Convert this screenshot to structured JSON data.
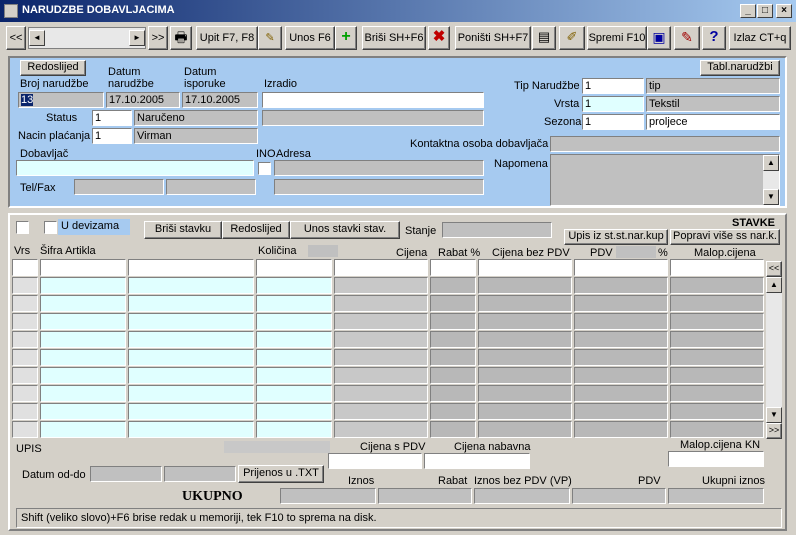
{
  "window": {
    "title": "NARUDZBE DOBAVLJACIMA"
  },
  "toolbar": {
    "upit": "Upit F7, F8",
    "unos": "Unos F6",
    "brisi": "Briši  SH+F6",
    "ponisti": "Poništi SH+F7",
    "spremi": "Spremi F10",
    "izlaz": "Izlaz CT+q",
    "nav_first": "<<",
    "nav_last": ">>"
  },
  "header": {
    "redoslijed": "Redoslijed",
    "tabl": "Tabl.narudžbi",
    "broj_label": "Broj narudžbe",
    "broj_value": "13",
    "datum_nar_label1": "Datum",
    "datum_nar_label2": "narudžbe",
    "datum_nar_value": "17.10.2005",
    "datum_isp_label1": "Datum",
    "datum_isp_label2": "isporuke",
    "datum_isp_value": "17.10.2005",
    "izradio_label": "Izradio",
    "status_label": "Status",
    "status_code": "1",
    "status_value": "Naručeno",
    "placanje_label": "Nacin plaćanja",
    "placanje_code": "1",
    "placanje_value": "Virman",
    "tip_label": "Tip Narudžbe",
    "tip_code": "1",
    "tip_value": "tip",
    "vrsta_label": "Vrsta",
    "vrsta_code": "1",
    "vrsta_value": "Tekstil",
    "sezona_label": "Sezona",
    "sezona_code": "1",
    "sezona_value": "proljece",
    "kontakt_label": "Kontaktna osoba dobavljača",
    "napomena_label": "Napomena",
    "dobavljac_label": "Dobavljač",
    "ino_label": "INO",
    "adresa_label": "Adresa",
    "telfax_label": "Tel/Fax"
  },
  "items": {
    "u_devizama": "U devizama",
    "brisi_stavku": "Briši stavku",
    "redoslijed": "Redoslijed",
    "unos_stavki": "Unos stavki stav.",
    "stanje_label": "Stanje",
    "stavke_title": "STAVKE",
    "upis_st": "Upis iz st.st.nar.kup",
    "popravi": "Popravi više ss nar.k.",
    "col_vrs": "Vrs",
    "col_sifra": "Šifra Artikla",
    "col_kolicina": "Količina",
    "col_cijena": "Cijena",
    "col_rabat": "Rabat %",
    "col_bez_pdv": "Cijena bez PDV",
    "col_pdv": "PDV",
    "col_pct": "%",
    "col_malop": "Malop.cijena",
    "nav_top": "<<",
    "nav_bottom": ">>"
  },
  "footer": {
    "upis": "UPIS",
    "cijena_s_pdv": "Cijena s PDV",
    "cijena_nabavna": "Cijena nabavna",
    "malop_kn": "Malop.cijena KN",
    "datum_od_do": "Datum  od-do",
    "prijenos": "Prijenos u .TXT",
    "iznos": "Iznos",
    "rabat": "Rabat",
    "iznos_bez_pdv": "Iznos bez PDV (VP)",
    "pdv": "PDV",
    "ukupni_iznos": "Ukupni iznos",
    "ukupno": "UKUPNO",
    "status_text": "Shift (veliko slovo)+F6 brise redak u memoriji, tek F10 to sprema na disk."
  }
}
